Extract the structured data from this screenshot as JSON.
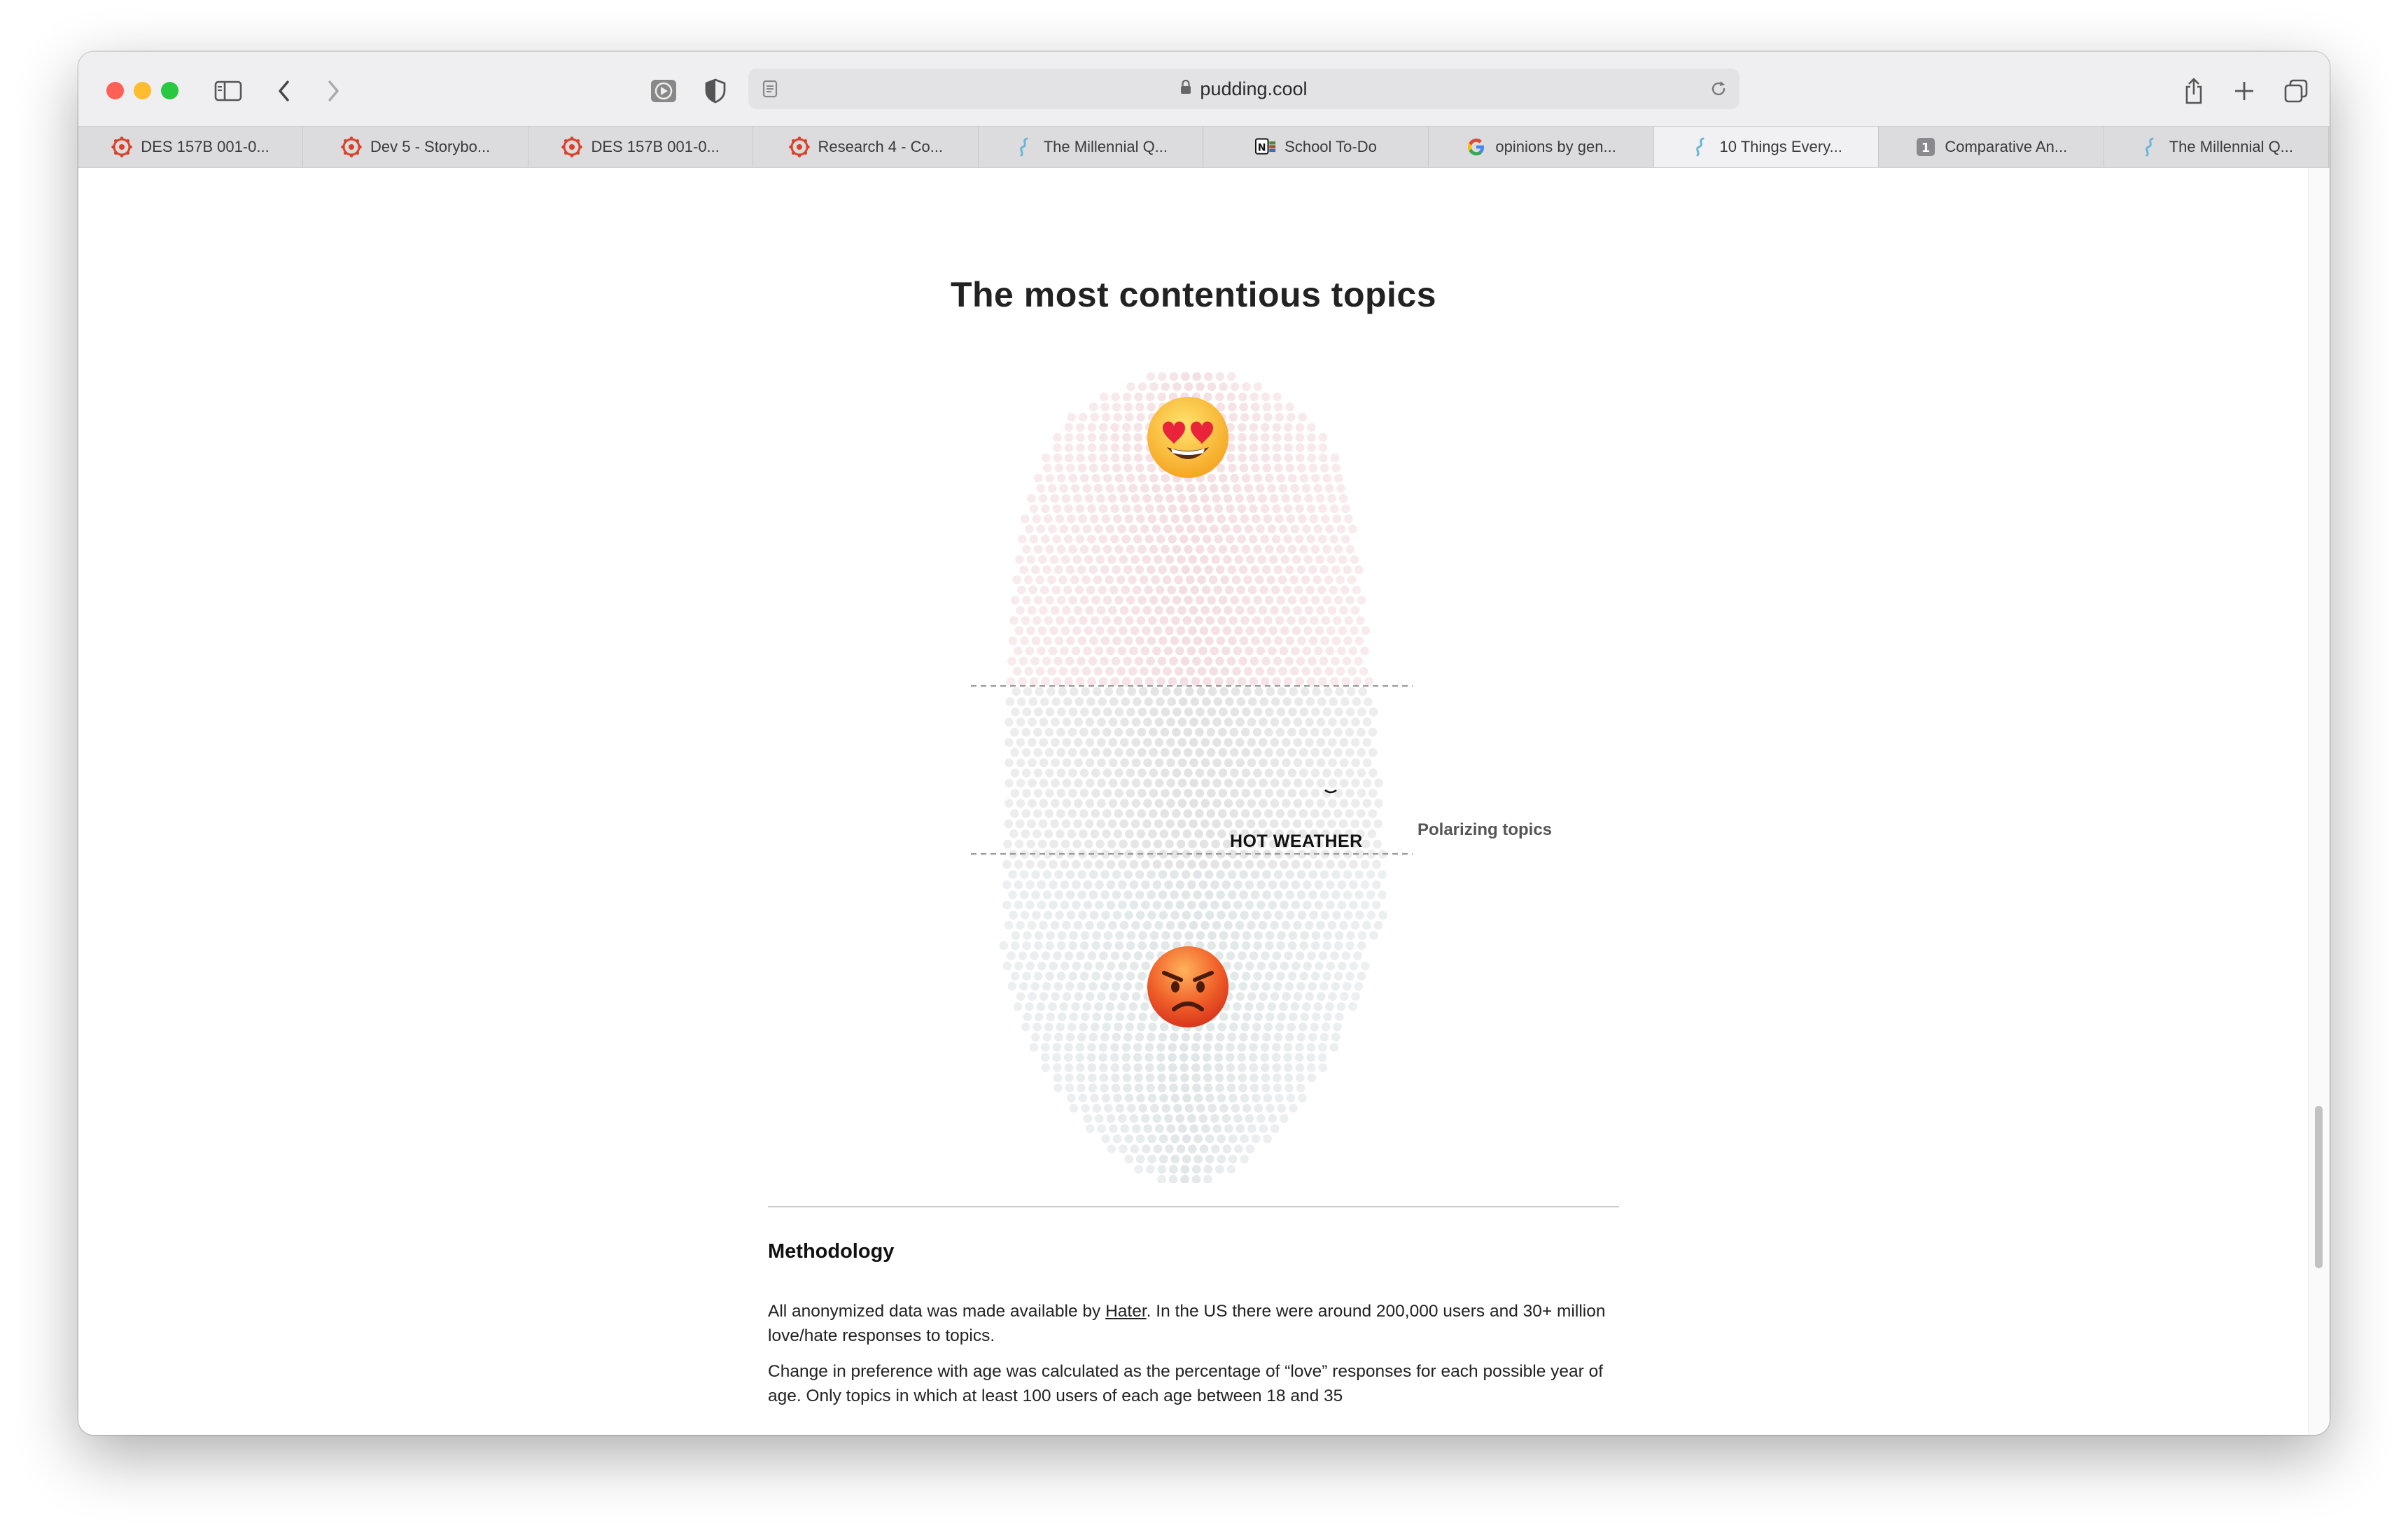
{
  "browser": {
    "url": "pudding.cool",
    "tabs": [
      {
        "label": "DES 157B 001-0...",
        "favicon": "canvas-icon"
      },
      {
        "label": "Dev 5 - Storybo...",
        "favicon": "canvas-icon"
      },
      {
        "label": "DES 157B 001-0...",
        "favicon": "canvas-icon"
      },
      {
        "label": "Research 4 - Co...",
        "favicon": "canvas-icon"
      },
      {
        "label": "The Millennial Q...",
        "favicon": "pudding-icon"
      },
      {
        "label": "School To-Do",
        "favicon": "notion-icon"
      },
      {
        "label": "opinions by gen...",
        "favicon": "google-icon"
      },
      {
        "label": "10 Things Every...",
        "favicon": "pudding-icon",
        "active": true
      },
      {
        "label": "Comparative An...",
        "favicon": "number-1-icon"
      },
      {
        "label": "The Millennial Q...",
        "favicon": "pudding-icon"
      }
    ]
  },
  "page": {
    "title": "The most contentious topics",
    "chart": {
      "highlight_label": "HOT WEATHER",
      "band_label": "Polarizing topics",
      "top_emoji": "heart-eyes-emoji",
      "bottom_emoji": "angry-face-emoji",
      "colors": {
        "love": "#f2dbe0",
        "middle": "#dfdfdf",
        "hate": "#dde3e4",
        "dashed": "#9a9a9a"
      }
    },
    "methodology": {
      "heading": "Methodology",
      "p1_before": "All anonymized data was made available by ",
      "p1_link": "Hater",
      "p1_after": ". In the US there were around 200,000 users and 30+ million love/hate responses to topics.",
      "p2": "Change in preference with age was calculated as the percentage of “love” responses for each possible year of age. Only topics in which at least 100 users of each age between 18 and 35"
    }
  }
}
